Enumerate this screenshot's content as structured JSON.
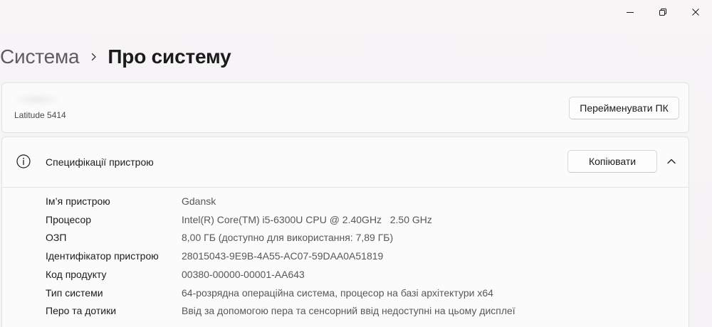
{
  "window": {
    "controls": {
      "minimize_icon": "minimize-icon",
      "maximize_icon": "restore-icon",
      "close_icon": "close-icon"
    }
  },
  "breadcrumb": {
    "parent": "Система",
    "separator_icon": "chevron-right-icon",
    "current": "Про систему"
  },
  "device": {
    "model": "Latitude 5414",
    "rename_button": "Перейменувати ПК"
  },
  "specs": {
    "title": "Специфікації пристрою",
    "copy_button": "Копіювати",
    "rows": [
      {
        "label": "Ім’я пристрою",
        "value": "Gdansk"
      },
      {
        "label": "Процесор",
        "value": "Intel(R) Core(TM) i5-6300U CPU @ 2.40GHz   2.50 GHz"
      },
      {
        "label": "ОЗП",
        "value": "8,00 ГБ (доступно для використання: 7,89 ГБ)"
      },
      {
        "label": "Ідентифікатор пристрою",
        "value": "28015043-9E9B-4A55-AC07-59DAA0A51819"
      },
      {
        "label": "Код продукту",
        "value": "00380-00000-00001-AA643"
      },
      {
        "label": "Тип системи",
        "value": "64-розрядна операційна система, процесор на базі архітектури x64"
      },
      {
        "label": "Перо та дотики",
        "value": "Ввід за допомогою пера та сенсорний ввід недоступні на цьому дисплеї"
      }
    ]
  }
}
